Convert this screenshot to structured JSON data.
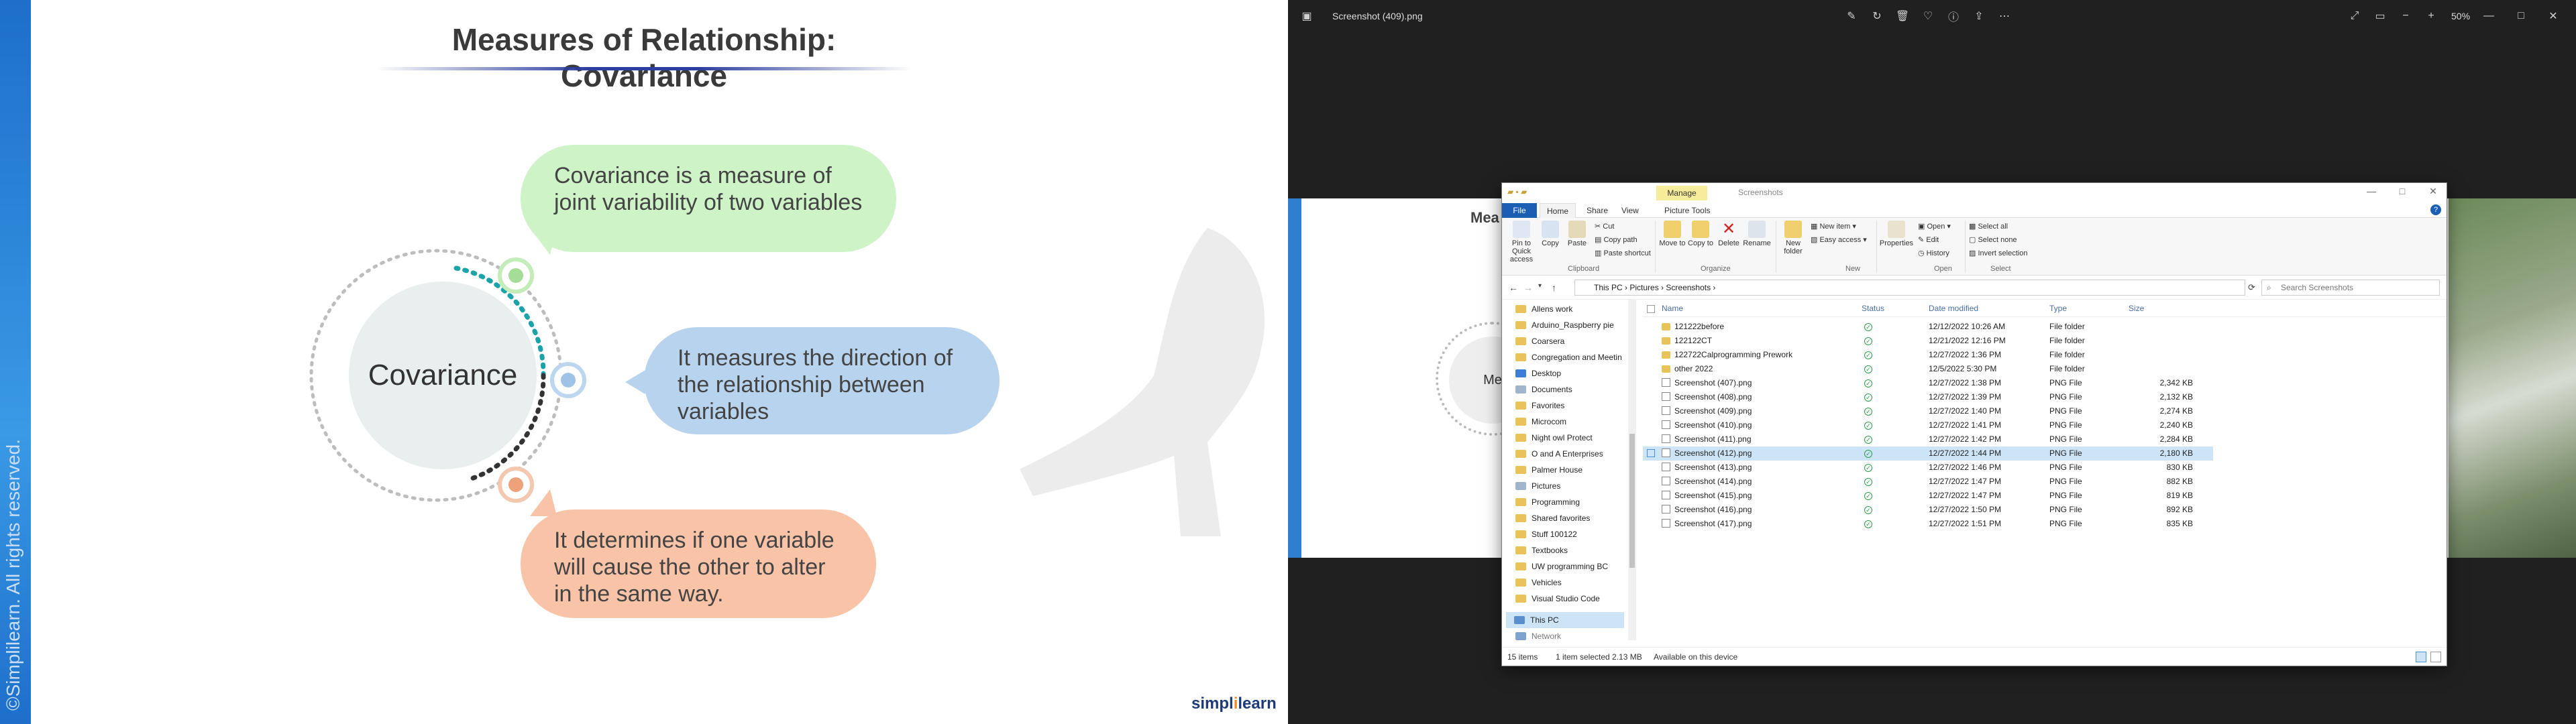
{
  "slide": {
    "title": "Measures of Relationship: Covariance",
    "center_label": "Covariance",
    "bubbles": [
      {
        "text": "Covariance is a measure of joint variability of two variables",
        "color": "#cdf3c7"
      },
      {
        "text": "It measures the direction of the relationship between variables",
        "color": "#b7d3ee"
      },
      {
        "text": "It determines if one variable will cause the other to alter in the same way.",
        "color": "#f8c3a6"
      }
    ],
    "copyright": "©Simplilearn. All rights reserved.",
    "logo_main": "simpl",
    "logo_accent": "i",
    "logo_end": "learn"
  },
  "viewer": {
    "filename": "Screenshot (409).png",
    "zoom": "50%",
    "bg_title_fragment": "Mea",
    "bg_center_fragment": "Me"
  },
  "explorer": {
    "manage_label": "Manage",
    "window_title": "Screenshots",
    "tabs": [
      "File",
      "Home",
      "Share",
      "View",
      "Picture Tools"
    ],
    "ribbon": {
      "pin_label": "Pin to Quick access",
      "copy_label": "Copy",
      "paste_label": "Paste",
      "cut_label": "Cut",
      "copy_path_label": "Copy path",
      "paste_shortcut_label": "Paste shortcut",
      "move_to_label": "Move to",
      "copy_to_label": "Copy to",
      "delete_label": "Delete",
      "rename_label": "Rename",
      "new_folder_label": "New folder",
      "new_item_label": "New item",
      "easy_access_label": "Easy access",
      "properties_label": "Properties",
      "open_label": "Open",
      "edit_label": "Edit",
      "history_label": "History",
      "select_all_label": "Select all",
      "select_none_label": "Select none",
      "invert_selection_label": "Invert selection",
      "groups": [
        "Clipboard",
        "Organize",
        "New",
        "Open",
        "Select"
      ]
    },
    "breadcrumb": [
      "This PC",
      "Pictures",
      "Screenshots"
    ],
    "search_placeholder": "Search Screenshots",
    "nav_items": [
      "Allens work",
      "Arduino_Raspberry pie",
      "Coarsera",
      "Congregation and Meetin",
      "Desktop",
      "Documents",
      "Favorites",
      "Microcom",
      "Night owl Protect",
      "O and A Enterprises",
      "Palmer House",
      "Pictures",
      "Programming",
      "Shared favorites",
      "Stuff 100122",
      "Textbooks",
      "UW programming BC",
      "Vehicles",
      "Visual Studio Code",
      "This PC"
    ],
    "nav_extra": "Network",
    "columns": [
      "Name",
      "Status",
      "Date modified",
      "Type",
      "Size"
    ],
    "files": [
      {
        "name": "121222before",
        "date": "12/12/2022 10:26 AM",
        "type": "File folder",
        "size": "",
        "kind": "folder"
      },
      {
        "name": "122122CT",
        "date": "12/21/2022 12:16 PM",
        "type": "File folder",
        "size": "",
        "kind": "folder"
      },
      {
        "name": "122722Calprogramming Prework",
        "date": "12/27/2022 1:36 PM",
        "type": "File folder",
        "size": "",
        "kind": "folder"
      },
      {
        "name": "other 2022",
        "date": "12/5/2022 5:30 PM",
        "type": "File folder",
        "size": "",
        "kind": "folder"
      },
      {
        "name": "Screenshot (407).png",
        "date": "12/27/2022 1:38 PM",
        "type": "PNG File",
        "size": "2,342 KB",
        "kind": "png"
      },
      {
        "name": "Screenshot (408).png",
        "date": "12/27/2022 1:39 PM",
        "type": "PNG File",
        "size": "2,132 KB",
        "kind": "png"
      },
      {
        "name": "Screenshot (409).png",
        "date": "12/27/2022 1:40 PM",
        "type": "PNG File",
        "size": "2,274 KB",
        "kind": "png"
      },
      {
        "name": "Screenshot (410).png",
        "date": "12/27/2022 1:41 PM",
        "type": "PNG File",
        "size": "2,240 KB",
        "kind": "png"
      },
      {
        "name": "Screenshot (411).png",
        "date": "12/27/2022 1:42 PM",
        "type": "PNG File",
        "size": "2,284 KB",
        "kind": "png"
      },
      {
        "name": "Screenshot (412).png",
        "date": "12/27/2022 1:44 PM",
        "type": "PNG File",
        "size": "2,180 KB",
        "kind": "png",
        "selected": true
      },
      {
        "name": "Screenshot (413).png",
        "date": "12/27/2022 1:46 PM",
        "type": "PNG File",
        "size": "830 KB",
        "kind": "png"
      },
      {
        "name": "Screenshot (414).png",
        "date": "12/27/2022 1:47 PM",
        "type": "PNG File",
        "size": "882 KB",
        "kind": "png"
      },
      {
        "name": "Screenshot (415).png",
        "date": "12/27/2022 1:47 PM",
        "type": "PNG File",
        "size": "819 KB",
        "kind": "png"
      },
      {
        "name": "Screenshot (416).png",
        "date": "12/27/2022 1:50 PM",
        "type": "PNG File",
        "size": "892 KB",
        "kind": "png"
      },
      {
        "name": "Screenshot (417).png",
        "date": "12/27/2022 1:51 PM",
        "type": "PNG File",
        "size": "835 KB",
        "kind": "png"
      }
    ],
    "status": {
      "items": "15 items",
      "selected": "1 item selected  2.13 MB",
      "availability": "Available on this device"
    }
  }
}
